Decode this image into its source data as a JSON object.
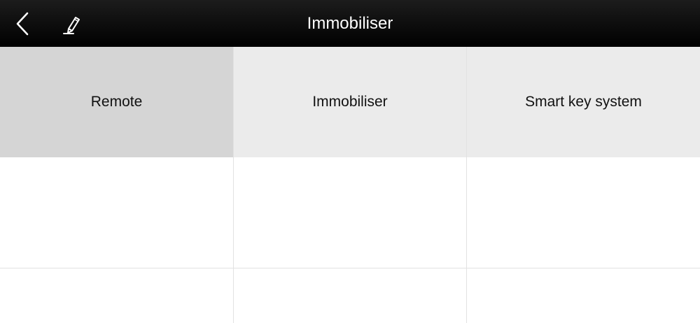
{
  "header": {
    "title": "Immobiliser",
    "back_icon": "chevron-left-icon",
    "edit_icon": "pencil-icon"
  },
  "grid": {
    "items": [
      {
        "label": "Remote",
        "selected": true
      },
      {
        "label": "Immobiliser",
        "selected": false
      },
      {
        "label": "Smart key system",
        "selected": false
      }
    ]
  },
  "colors": {
    "header_bg": "#000000",
    "header_text": "#ffffff",
    "selected_tile": "#d5d5d5",
    "tile": "#ebebeb",
    "grid_line": "#e2e2e2"
  }
}
